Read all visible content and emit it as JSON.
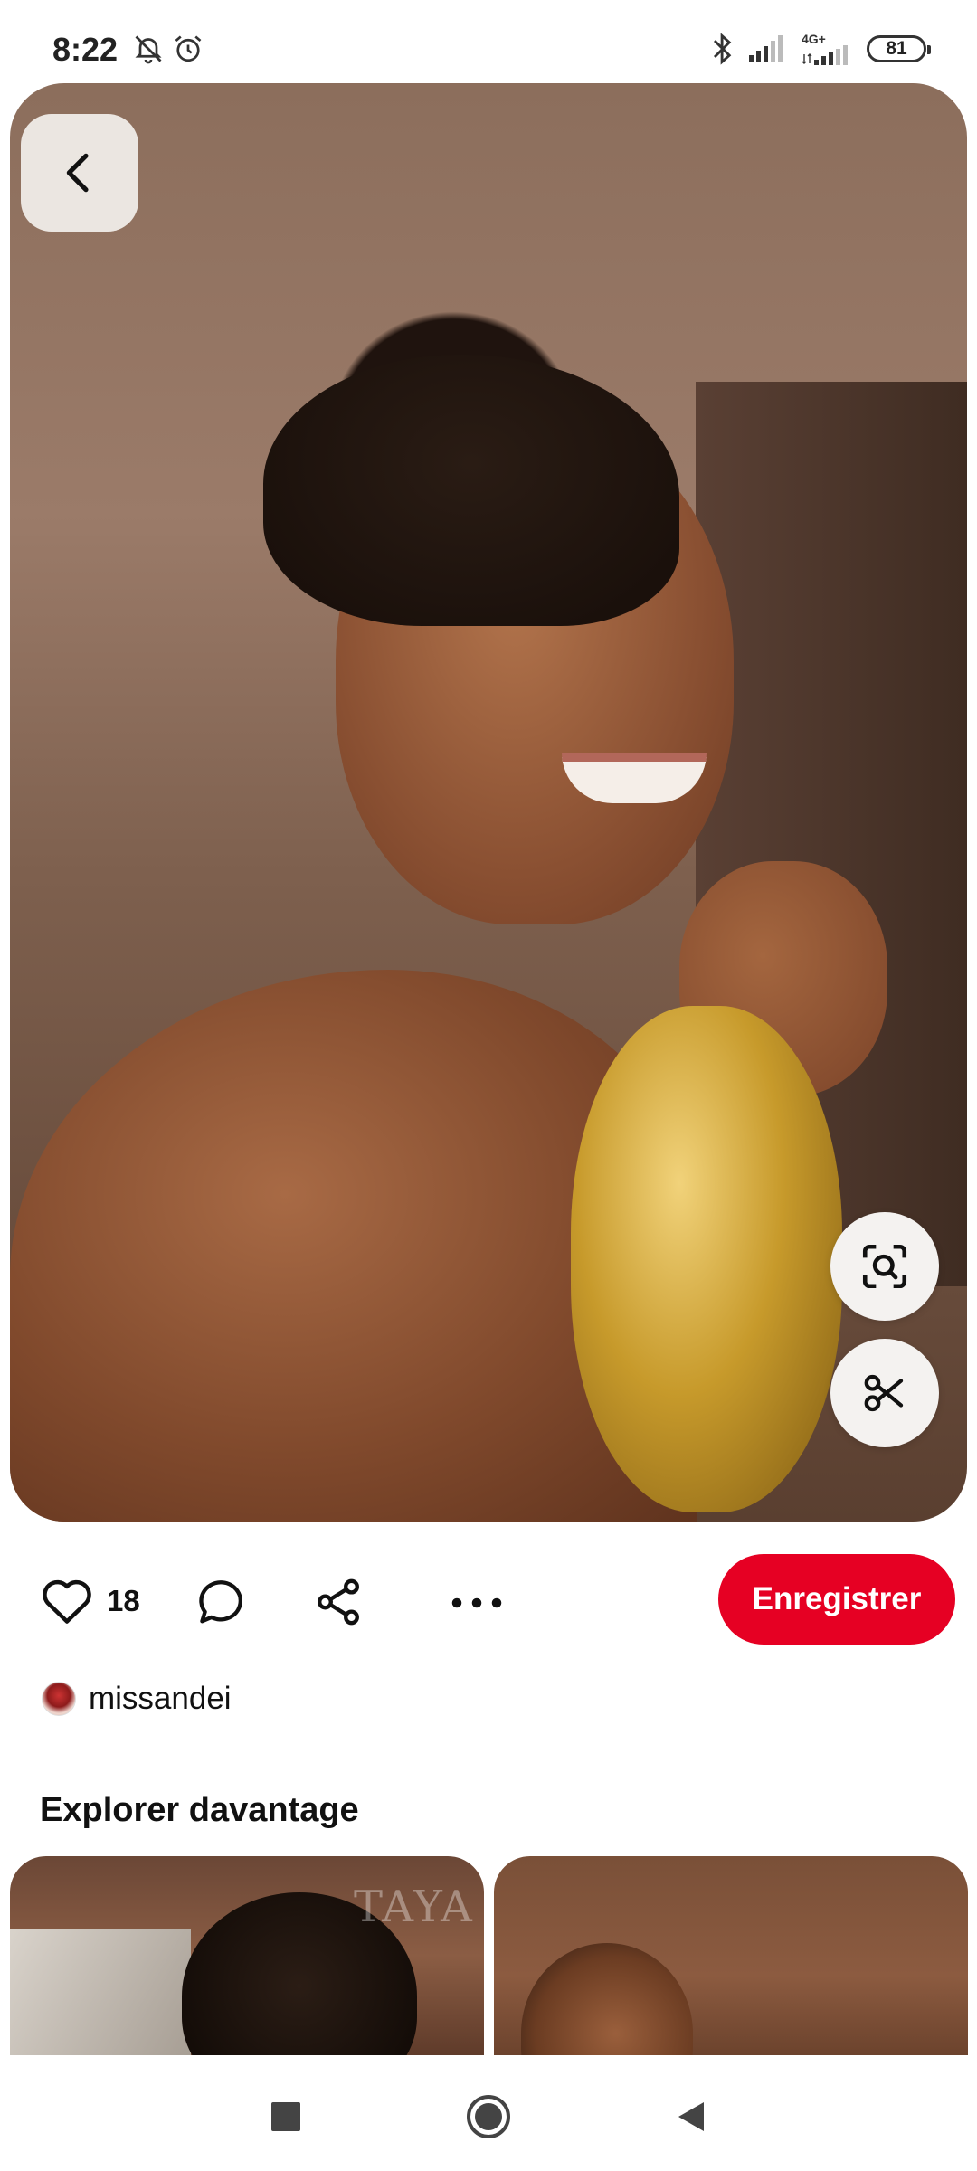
{
  "status_bar": {
    "time": "8:22",
    "network": "4G+",
    "battery": "81"
  },
  "pin": {
    "like_count": "18",
    "save_label": "Enregistrer",
    "author": "missandei"
  },
  "explore": {
    "title": "Explorer davantage",
    "tile1_watermark": "TAYA"
  },
  "colors": {
    "accent": "#e60023"
  },
  "icons": [
    "back-arrow-icon",
    "visual-search-icon",
    "scissors-icon",
    "heart-icon",
    "comment-icon",
    "share-icon",
    "more-icon"
  ]
}
